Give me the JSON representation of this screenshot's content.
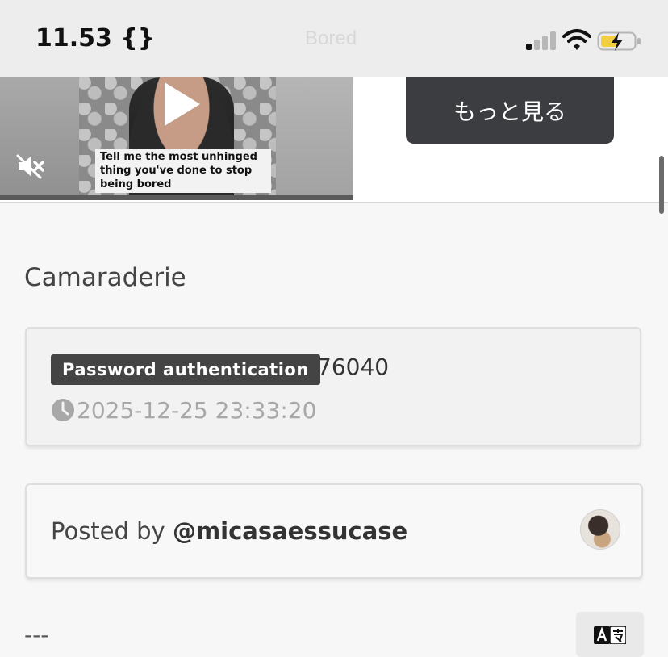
{
  "status_bar": {
    "time": "11.53 {}",
    "ghost_title": "Bored"
  },
  "video": {
    "caption": "Tell me the most unhinged thing you've done to stop being bored"
  },
  "more_button": {
    "label": "もっと見る"
  },
  "post": {
    "category": "Camaraderie",
    "badge": "Password authentication",
    "number": "76040",
    "timestamp": "2025-12-25 23:33:20",
    "posted_prefix": "Posted by",
    "handle": "@micasaessucase",
    "separator": "---"
  },
  "icons": [
    "play-icon",
    "mute-icon",
    "signal-icon",
    "wifi-icon",
    "battery-charging-icon",
    "clock-icon",
    "translate-icon"
  ]
}
